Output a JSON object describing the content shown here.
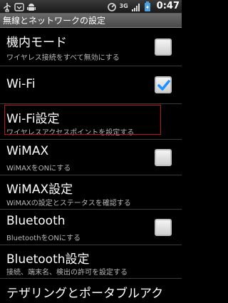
{
  "status_bar": {
    "time": "0:47",
    "network": "3G",
    "icons": [
      "usb-icon",
      "notification-icon",
      "android-icon",
      "sync-icon",
      "signal-icon",
      "battery-icon"
    ]
  },
  "header": {
    "title": "無線とネットワークの設定"
  },
  "settings": [
    {
      "title": "機内モード",
      "summary": "ワイヤレス接続をすべて無効にする",
      "checkbox": true,
      "checked": false
    },
    {
      "title": "Wi-Fi",
      "summary": "",
      "checkbox": true,
      "checked": true
    },
    {
      "title": "Wi-Fi設定",
      "summary": "ワイヤレスアクセスポイントを設定する",
      "checkbox": false
    },
    {
      "title": "WiMAX",
      "summary": "WiMAXをONにする",
      "checkbox": true,
      "checked": false
    },
    {
      "title": "WiMAX設定",
      "summary": "WiMAXの設定とステータスを確認する",
      "checkbox": false
    },
    {
      "title": "Bluetooth",
      "summary": "BluetoothをONにする",
      "checkbox": true,
      "checked": false
    },
    {
      "title": "Bluetooth設定",
      "summary": "接続、端末名、検出の許可を設定する",
      "checkbox": false
    },
    {
      "title": "テザリングとポータブルアク",
      "summary": "",
      "checkbox": false
    }
  ],
  "colors": {
    "accent_check": "#1e90ff",
    "highlight": "#c0141c"
  }
}
